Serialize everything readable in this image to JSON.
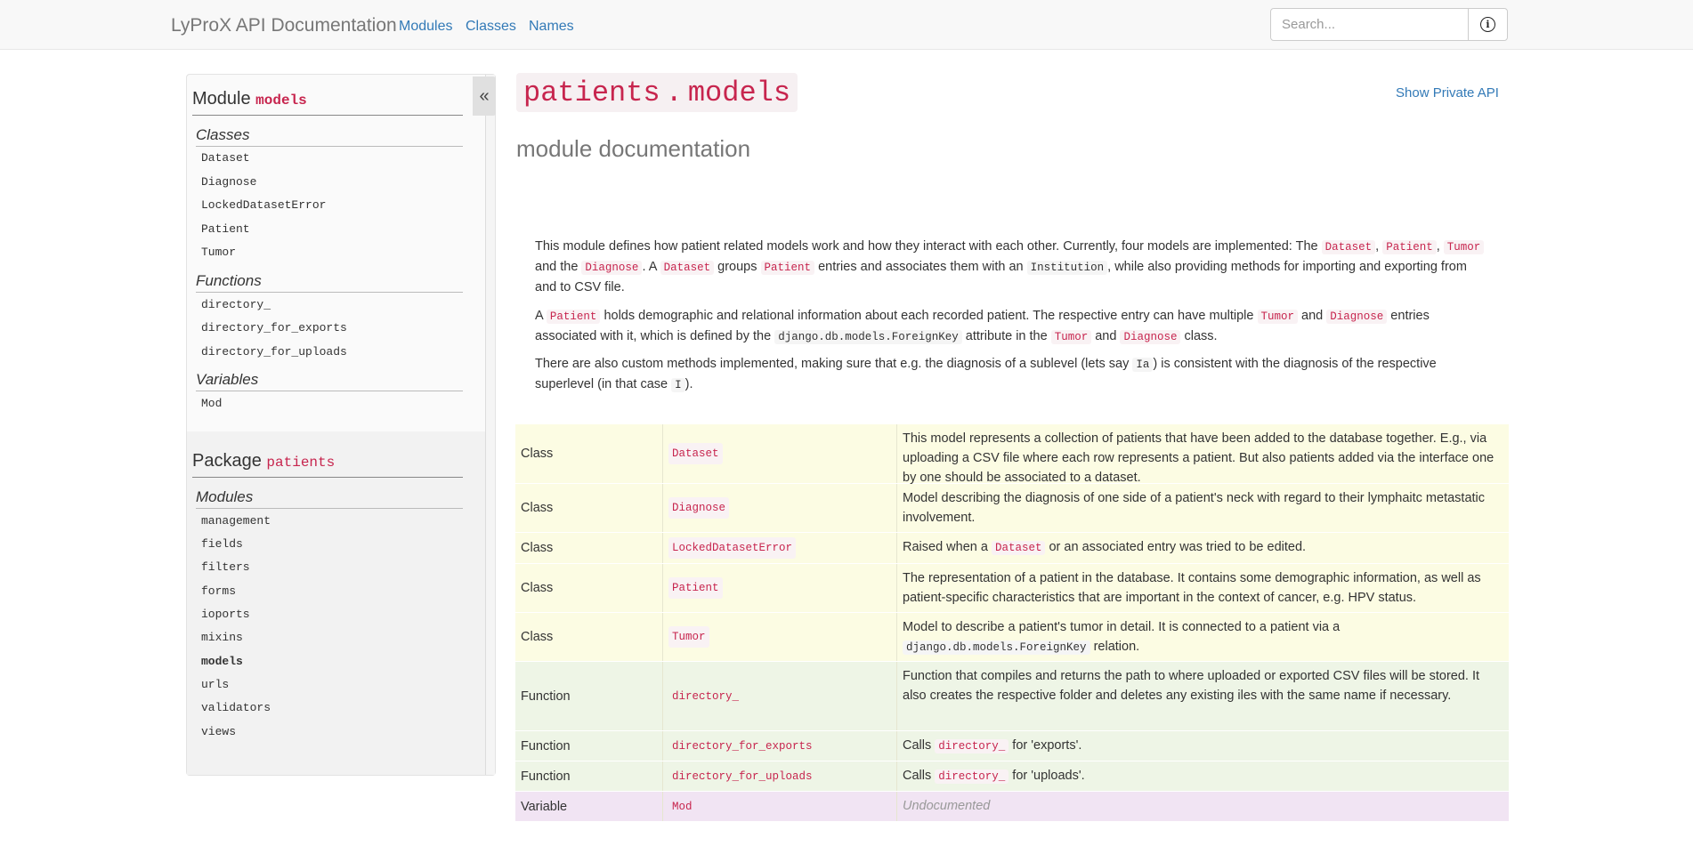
{
  "navbar": {
    "brand": "LyProX API Documentation",
    "links": [
      "Modules",
      "Classes",
      "Names"
    ],
    "search_placeholder": "Search...",
    "info_icon": "info-icon"
  },
  "sidebar": {
    "collapse_label": "«",
    "module": {
      "prefix": "Module",
      "name": "models",
      "sections": [
        {
          "title": "Classes",
          "items": [
            "Dataset",
            "Diagnose",
            "LockedDatasetError",
            "Patient",
            "Tumor"
          ]
        },
        {
          "title": "Functions",
          "items": [
            "directory_",
            "directory_for_exports",
            "directory_for_uploads"
          ]
        },
        {
          "title": "Variables",
          "items": [
            "Mod"
          ]
        }
      ]
    },
    "package": {
      "prefix": "Package",
      "name": "patients",
      "section_title": "Modules",
      "items": [
        "management",
        "fields",
        "filters",
        "forms",
        "ioports",
        "mixins",
        "models",
        "urls",
        "validators",
        "views"
      ],
      "active": "models"
    }
  },
  "main": {
    "title_pkg": "patients",
    "title_sep": ".",
    "title_mod": "models",
    "show_private": "Show Private API",
    "subtitle": "module documentation",
    "p1": {
      "t1": "This module defines how patient related models work and how they interact with each other. Currently, four models are implemented: The ",
      "c1": "Dataset",
      "t2": ",",
      "c2": "Patient",
      "t3": ",",
      "c3": "Tumor",
      "t4": " and the ",
      "c4": "Diagnose",
      "t5": ". A ",
      "c5": "Dataset",
      "t6": " groups ",
      "c6": "Patient",
      "t7": " entries and associates them with an ",
      "c7": "Institution",
      "t8": ", while also providing methods for importing and exporting from and to CSV file."
    },
    "p2": {
      "t1": "A ",
      "c1": "Patient",
      "t2": " holds demographic and relational information about each recorded patient. The respective entry can have multiple ",
      "c2": "Tumor",
      "t3": " and ",
      "c3": "Diagnose",
      "t4": " entries associated with it, which is defined by the ",
      "c4": "django.db.models.ForeignKey",
      "t5": " attribute in the ",
      "c5": "Tumor",
      "t6": " and ",
      "c6": "Diagnose",
      "t7": " class."
    },
    "p3": {
      "t1": "There are also custom methods implemented, making sure that e.g. the diagnosis of a sublevel (lets say ",
      "c1": "Ia",
      "t2": ") is consistent with the diagnosis of the respective superlevel (in that case ",
      "c2": "I",
      "t3": ")."
    },
    "table": [
      {
        "kind": "Class",
        "name": "Dataset",
        "desc": "This model represents a collection of patients that have been added to the database together. E.g., via uploading a CSV file where each row represents a patient. But also patients added via the interface one by one should be associated to a dataset."
      },
      {
        "kind": "Class",
        "name": "Diagnose",
        "desc": "Model describing the diagnosis of one side of a patient's neck with regard to their lymphaitc metastatic involvement."
      },
      {
        "kind": "Class",
        "name": "LockedDatasetError",
        "desc_pre": "Raised when a ",
        "desc_code": "Dataset",
        "desc_post": " or an associated entry was tried to be edited."
      },
      {
        "kind": "Class",
        "name": "Patient",
        "desc": "The representation of a patient in the database. It contains some demographic information, as well as patient-specific characteristics that are important in the context of cancer, e.g. HPV status."
      },
      {
        "kind": "Class",
        "name": "Tumor",
        "desc_pre": "Model to describe a patient's tumor in detail. It is connected to a patient via a ",
        "desc_code": "django.db.models.ForeignKey",
        "desc_post": " relation."
      },
      {
        "kind": "Function",
        "name": "directory_",
        "desc": "Function that compiles and returns the path to where uploaded or exported CSV files will be stored. It also creates the respective folder and deletes any existing iles with the same name if necessary."
      },
      {
        "kind": "Function",
        "name": "directory_for_exports",
        "desc_pre": "Calls ",
        "desc_code": "directory_",
        "desc_post": " for 'exports'."
      },
      {
        "kind": "Function",
        "name": "directory_for_uploads",
        "desc_pre": "Calls ",
        "desc_code": "directory_",
        "desc_post": " for 'uploads'."
      },
      {
        "kind": "Variable",
        "name": "Mod",
        "desc": "Undocumented"
      }
    ]
  }
}
